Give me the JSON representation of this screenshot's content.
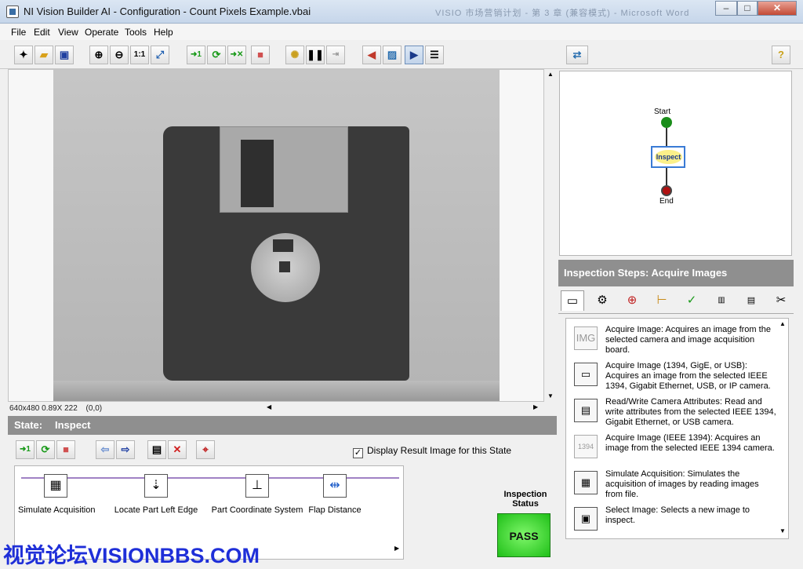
{
  "window": {
    "title": "NI Vision Builder AI - Configuration - Count Pixels Example.vbai",
    "ghost_title": "VISIO 市场营销计划 - 第 3 章 (兼容模式) - Microsoft Word"
  },
  "menu": [
    "File",
    "Edit",
    "View",
    "Operate",
    "Tools",
    "Help"
  ],
  "image_status": {
    "size": "640x480",
    "zoom": "0.89X",
    "value": "222",
    "coords": "(0,0)"
  },
  "state": {
    "label": "State:",
    "name": "Inspect"
  },
  "display_result": {
    "label": "Display Result Image for this State",
    "checked": true
  },
  "steps": [
    {
      "label": "Simulate Acquisition",
      "icon": "simulate-acquisition-icon"
    },
    {
      "label": "Locate Part Left Edge",
      "icon": "edge-icon"
    },
    {
      "label": "Part Coordinate System",
      "icon": "coordinate-axes-icon"
    },
    {
      "label": "Flap Distance",
      "icon": "caliper-icon"
    }
  ],
  "inspection_status": {
    "label": "Inspection Status",
    "value": "PASS",
    "color": "#33cc2a"
  },
  "flow": {
    "start": "Start",
    "inspect": "Inspect",
    "end": "End"
  },
  "inspection_steps": {
    "title": "Inspection Steps: Acquire Images",
    "items": [
      {
        "text": "Acquire Image:  Acquires an image from the selected camera and image acquisition board."
      },
      {
        "text": "Acquire Image (1394, GigE, or USB):  Acquires an image from the selected IEEE 1394, Gigabit Ethernet, USB, or IP camera."
      },
      {
        "text": "Read/Write Camera Attributes:  Read and write attributes from the selected IEEE 1394, Gigabit Ethernet, or USB camera."
      },
      {
        "text": "Acquire Image (IEEE 1394):  Acquires an image from the selected IEEE 1394 camera."
      },
      {
        "text": "Simulate Acquisition:  Simulates the acquisition of images by reading images from file."
      },
      {
        "text": "Select Image:  Selects a new image to inspect."
      }
    ],
    "item_icon_labels": {
      "img": "IMG",
      "ieee": "1394"
    }
  },
  "watermark": "视觉论坛VISIONBBS.COM",
  "accent": "#8f8f8f"
}
